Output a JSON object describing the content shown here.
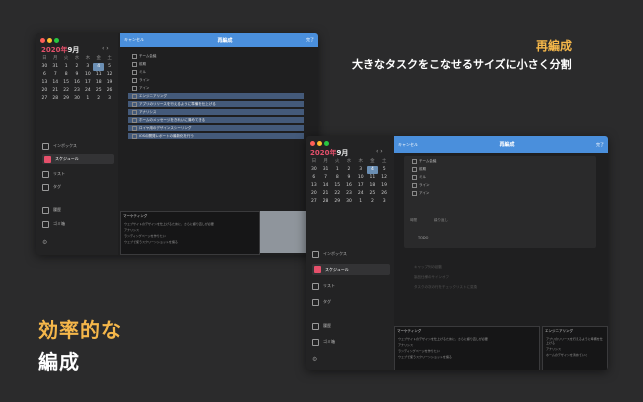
{
  "headline_right": {
    "title": "再編成",
    "subtitle": "大きなタスクをこなせるサイズに小さく分割"
  },
  "headline_left": {
    "line1": "効率的な",
    "line2": "編成"
  },
  "window_back": {
    "calendar": {
      "year": "2020年",
      "month": "9月",
      "weekdays": [
        "日",
        "月",
        "火",
        "水",
        "木",
        "金",
        "土"
      ],
      "days": [
        "30",
        "31",
        "1",
        "2",
        "3",
        "4",
        "5",
        "6",
        "7",
        "8",
        "9",
        "10",
        "11",
        "12",
        "13",
        "14",
        "15",
        "16",
        "17",
        "18",
        "19",
        "20",
        "21",
        "22",
        "23",
        "24",
        "25",
        "26",
        "27",
        "28",
        "29",
        "30",
        "1",
        "2",
        "3"
      ]
    },
    "nav": [
      "インボックス",
      "スケジュール",
      "リスト",
      "タグ",
      "履歴",
      "ゴミ箱"
    ],
    "topbar": {
      "cancel": "キャンセル",
      "title": "再編成",
      "done": "完了"
    },
    "tasks": [
      "チーム会議",
      "前期",
      "ミル",
      "ライン",
      "アイン",
      "エンジニアリング",
      "アプリのリリースを行えるように準備を仕上げる",
      "アナリシス",
      "ホームのメッセージをきれいに清めてきる",
      "ロイヤ用のデザインスシーリング",
      "iOSの開発レポートの最新化を行う"
    ],
    "card": {
      "title": "マーケティング",
      "lines": [
        "ウェブサイトのデザインを仕上げるために、さらに練り直しが必要",
        "アナリシス",
        "ランディングページを作りたい",
        "ウェブで使うスクリーンショットを撮る",
        "ジャーナルのアップデートをする"
      ]
    }
  },
  "window_front": {
    "calendar": {
      "year": "2020年",
      "month": "9月",
      "weekdays": [
        "日",
        "月",
        "火",
        "水",
        "木",
        "金",
        "土"
      ],
      "days": [
        "30",
        "31",
        "1",
        "2",
        "3",
        "4",
        "5",
        "6",
        "7",
        "8",
        "9",
        "10",
        "11",
        "12",
        "13",
        "14",
        "15",
        "16",
        "17",
        "18",
        "19",
        "20",
        "21",
        "22",
        "23",
        "24",
        "25",
        "26",
        "27",
        "28",
        "29",
        "30",
        "1",
        "2",
        "3"
      ]
    },
    "nav": [
      "インボックス",
      "スケジュール",
      "リスト",
      "タグ",
      "履歴",
      "ゴミ箱"
    ],
    "topbar": {
      "cancel": "キャンセル",
      "title": "再編成",
      "done": "完了"
    },
    "tasks": [
      "チーム会議",
      "前期",
      "ミル",
      "ライン",
      "アイン"
    ],
    "meta": [
      "時間",
      "繰り返し",
      "TODO"
    ],
    "ghost": [
      "キャップ列の起動",
      "製品仕様のサインオフ",
      "タスクの次の行をチェックリストに変換"
    ],
    "cards": [
      {
        "title": "マーケティング",
        "lines": [
          "ウェブサイトのデザインを仕上げるために、さらに練り直しが必要",
          "アナリシス",
          "ランディングページを作りたい",
          "ウェブで使うスクリーンショットを撮る",
          "ジャーナルのアップデートをする"
        ]
      },
      {
        "title": "エンジニアリング",
        "lines": [
          "アプリのリリースを行えるように準備を仕上げる",
          "アナリシス",
          "ホームのデザインを清めていく",
          "ロイヤ用のデザインシーリング",
          "iOSの開発レポートの最新化を行う"
        ]
      }
    ]
  }
}
